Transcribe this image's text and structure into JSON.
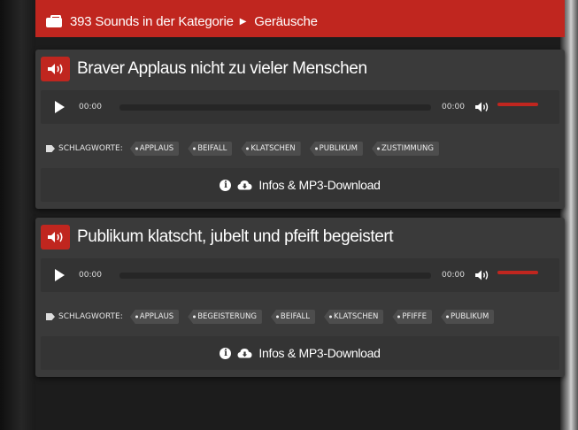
{
  "category_bar": {
    "count_text": "393 Sounds in der Kategorie",
    "category": "Geräusche",
    "bg_color": "#c0261f"
  },
  "sounds": [
    {
      "title": "Braver Applaus nicht zu vieler Menschen",
      "current_time": "00:00",
      "duration": "00:00",
      "tags_label": "SCHLAGWORTE:",
      "tags": [
        "APPLAUS",
        "BEIFALL",
        "KLATSCHEN",
        "PUBLIKUM",
        "ZUSTIMMUNG"
      ],
      "download_label": "Infos & MP3-Download"
    },
    {
      "title": "Publikum klatscht, jubelt und pfeift begeistert",
      "current_time": "00:00",
      "duration": "00:00",
      "tags_label": "SCHLAGWORTE:",
      "tags": [
        "APPLAUS",
        "BEGEISTERUNG",
        "BEIFALL",
        "KLATSCHEN",
        "PFIFFE",
        "PUBLIKUM"
      ],
      "download_label": "Infos & MP3-Download"
    }
  ],
  "icons": {
    "category": "briefcase-icon",
    "separator": "caret-right-icon",
    "title": "speaker-icon",
    "play": "play-icon",
    "volume": "volume-icon",
    "tags": "tag-icon",
    "info": "info-icon",
    "download": "cloud-download-icon"
  },
  "colors": {
    "accent": "#c0261f",
    "card": "#3a3a3a",
    "player": "#333333"
  }
}
